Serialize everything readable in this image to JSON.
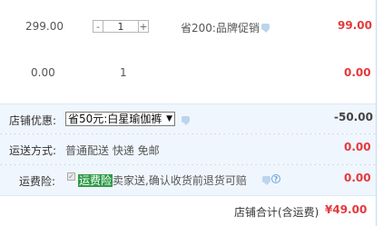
{
  "items": [
    {
      "price": "299.00",
      "quantity": "1",
      "promo_label": "省200:品牌促销",
      "subtotal": "99.00"
    },
    {
      "price": "0.00",
      "quantity": "1",
      "subtotal": "0.00"
    }
  ],
  "stepper": {
    "minus": "-",
    "plus": "+"
  },
  "shop_discount": {
    "label": "店铺优惠:",
    "selected_option": "省50元:白星瑜伽裤",
    "amount": "-50.00"
  },
  "shipping": {
    "label": "运送方式:",
    "method": "普通配送 快递 免邮",
    "cost": "0.00"
  },
  "insurance": {
    "label": "运费险:",
    "badge": "运费险",
    "description": "卖家送,确认收货前退货可赔",
    "cost": "0.00"
  },
  "total": {
    "label": "店铺合计(含运费)",
    "amount": "¥49.00"
  },
  "colors": {
    "price_red": "#e4393c",
    "row_blue": "#f0f6fd",
    "insurance_badge": "#2e9c48"
  },
  "icons": [
    "minus-icon",
    "plus-icon",
    "chat-bubble-icon",
    "dropdown-arrow-icon",
    "checkbox-icon",
    "help-icon"
  ]
}
